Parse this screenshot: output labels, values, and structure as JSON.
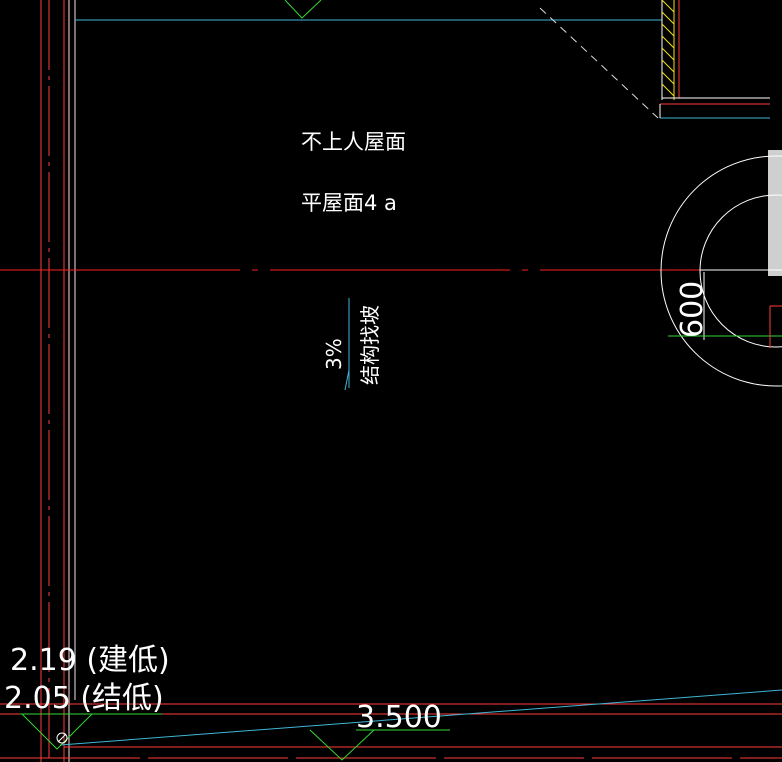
{
  "drawing": {
    "roof_title": "不上人屋面",
    "roof_type": "平屋面4 a",
    "slope_percent": "3%",
    "slope_note": "结构找坡",
    "circle_dimension": "600",
    "elevation_architectural": "2.19 (建低)",
    "elevation_structural": "2.05 (结低)",
    "elevation_main": "3.500"
  },
  "colors": {
    "background": "#000000",
    "wall_line": "#ff3b3b",
    "axis_line": "#ff2020",
    "cyan_line": "#3fb6d6",
    "white_line": "#ffffff",
    "green_line": "#35d635",
    "yellow_line": "#f3e21b",
    "grey_block": "#cfcfcf"
  }
}
